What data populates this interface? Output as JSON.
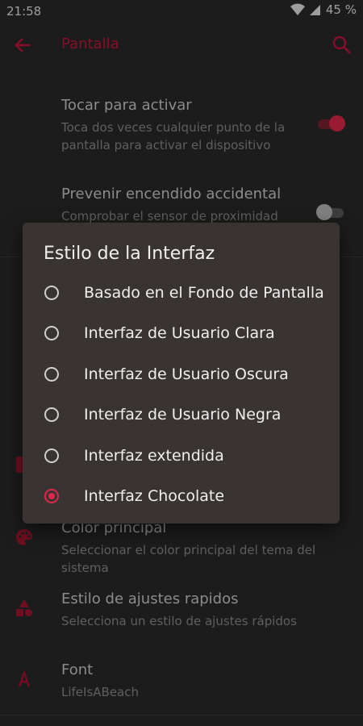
{
  "status_bar": {
    "time": "21:58",
    "battery": "45 %"
  },
  "app_bar": {
    "title": "Pantalla"
  },
  "settings": [
    {
      "title": "Tocar para activar",
      "summary": "Toca dos veces cualquier punto de la pantalla para activar el dispositivo",
      "toggle": true
    },
    {
      "title": "Prevenir encendido accidental",
      "summary": "Comprobar el sensor de proximidad",
      "toggle": false
    },
    {
      "title": "Color principal",
      "summary": "Seleccionar el color principal del tema del sistema",
      "icon": "palette-icon"
    },
    {
      "title": "Estilo de ajustes rapidos",
      "summary": "Selecciona un estilo de ajustes rápidos",
      "icon": "shapes-icon"
    },
    {
      "title": "Font",
      "summary": "LifeIsABeach",
      "icon": "font-icon"
    }
  ],
  "dialog": {
    "title": "Estilo de la Interfaz",
    "options": [
      {
        "label": "Basado en el Fondo de Pantalla",
        "selected": false
      },
      {
        "label": "Interfaz de Usuario Clara",
        "selected": false
      },
      {
        "label": "Interfaz de Usuario Oscura",
        "selected": false
      },
      {
        "label": "Interfaz de Usuario Negra",
        "selected": false
      },
      {
        "label": "Interfaz extendida",
        "selected": false
      },
      {
        "label": "Interfaz Chocolate",
        "selected": true
      }
    ]
  },
  "colors": {
    "accent": "#e0284a",
    "background": "#2a2a2a",
    "dialog": "#393432"
  }
}
